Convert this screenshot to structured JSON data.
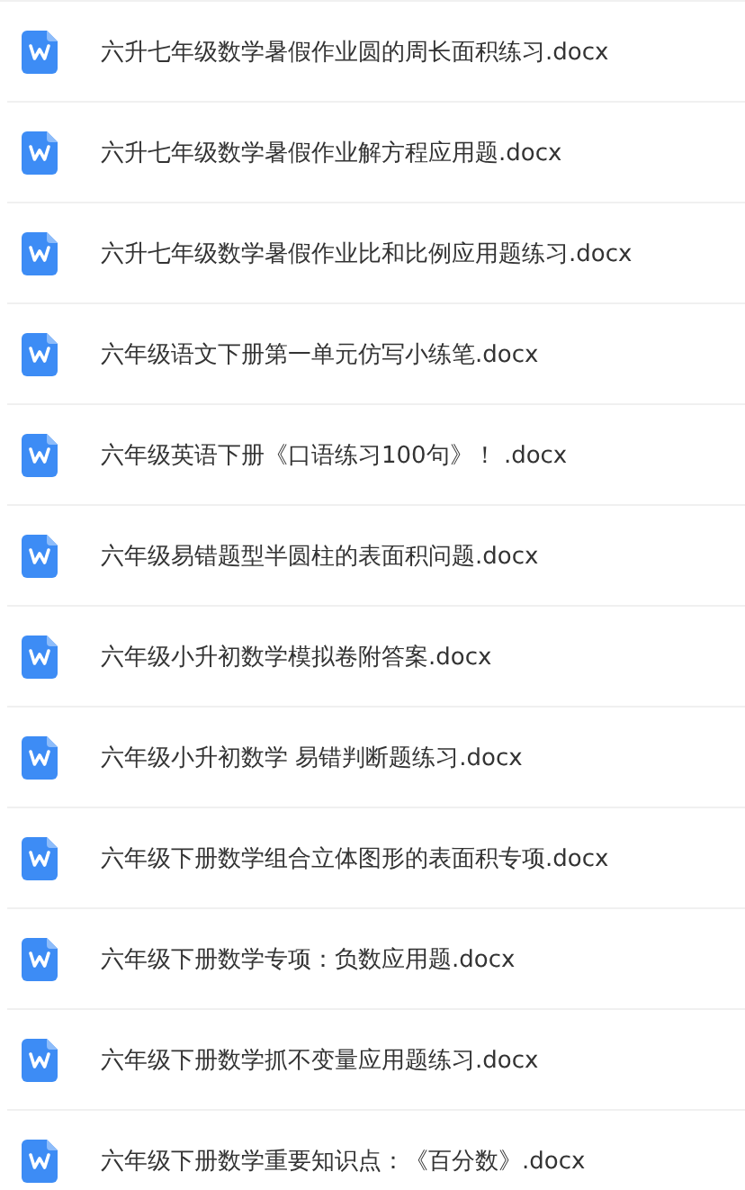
{
  "files": [
    {
      "name": "六升七年级数学暑假作业圆的周长面积练习.docx",
      "kind": "word"
    },
    {
      "name": "六升七年级数学暑假作业解方程应用题.docx",
      "kind": "word"
    },
    {
      "name": "六升七年级数学暑假作业比和比例应用题练习.docx",
      "kind": "word"
    },
    {
      "name": "六年级语文下册第一单元仿写小练笔.docx",
      "kind": "word"
    },
    {
      "name": "六年级英语下册《口语练习100句》！ .docx",
      "kind": "word"
    },
    {
      "name": "六年级易错题型半圆柱的表面积问题.docx",
      "kind": "word"
    },
    {
      "name": "六年级小升初数学模拟卷附答案.docx",
      "kind": "word"
    },
    {
      "name": "六年级小升初数学 易错判断题练习.docx",
      "kind": "word"
    },
    {
      "name": "六年级下册数学组合立体图形的表面积专项.docx",
      "kind": "word"
    },
    {
      "name": "六年级下册数学专项：负数应用题.docx",
      "kind": "word"
    },
    {
      "name": "六年级下册数学抓不变量应用题练习.docx",
      "kind": "word"
    },
    {
      "name": "六年级下册数学重要知识点：《百分数》.docx",
      "kind": "word"
    }
  ]
}
